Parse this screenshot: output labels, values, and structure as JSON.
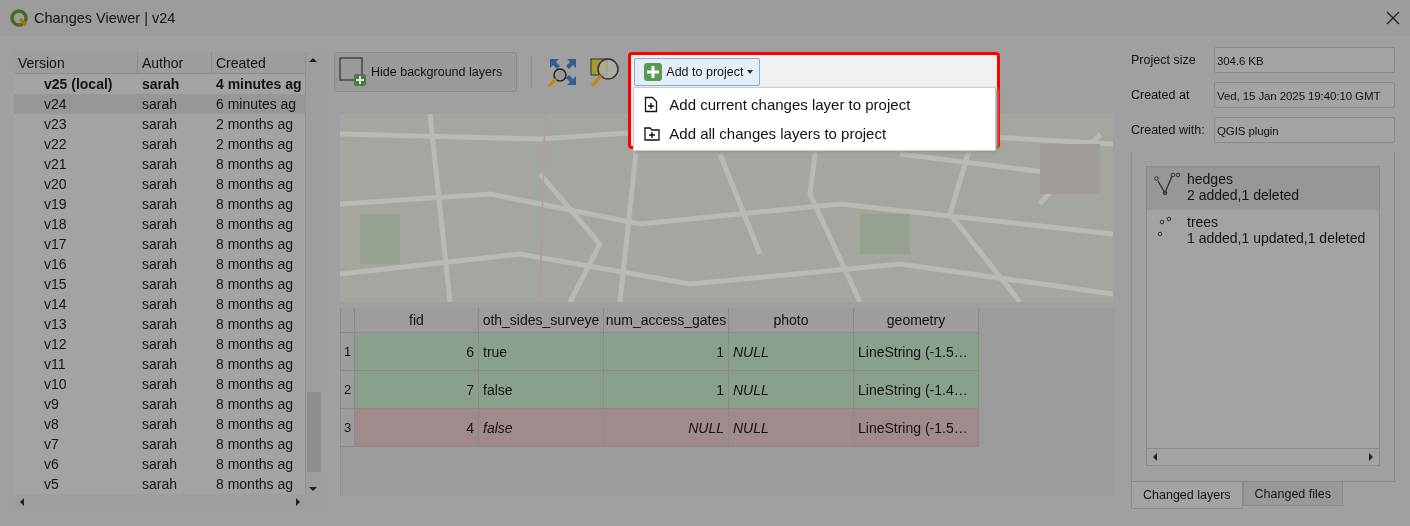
{
  "window": {
    "title": "Changes Viewer | v24"
  },
  "versions": {
    "columns": [
      "Version",
      "Author",
      "Created"
    ],
    "rows": [
      {
        "version": "v25 (local)",
        "author": "sarah",
        "created": "4 minutes ag",
        "local": true,
        "selected": false
      },
      {
        "version": "v24",
        "author": "sarah",
        "created": "6 minutes ag",
        "local": false,
        "selected": true
      },
      {
        "version": "v23",
        "author": "sarah",
        "created": "2 months ag",
        "local": false,
        "selected": false
      },
      {
        "version": "v22",
        "author": "sarah",
        "created": "2 months ag",
        "local": false,
        "selected": false
      },
      {
        "version": "v21",
        "author": "sarah",
        "created": "8 months ag",
        "local": false,
        "selected": false
      },
      {
        "version": "v20",
        "author": "sarah",
        "created": "8 months ag",
        "local": false,
        "selected": false
      },
      {
        "version": "v19",
        "author": "sarah",
        "created": "8 months ag",
        "local": false,
        "selected": false
      },
      {
        "version": "v18",
        "author": "sarah",
        "created": "8 months ag",
        "local": false,
        "selected": false
      },
      {
        "version": "v17",
        "author": "sarah",
        "created": "8 months ag",
        "local": false,
        "selected": false
      },
      {
        "version": "v16",
        "author": "sarah",
        "created": "8 months ag",
        "local": false,
        "selected": false
      },
      {
        "version": "v15",
        "author": "sarah",
        "created": "8 months ag",
        "local": false,
        "selected": false
      },
      {
        "version": "v14",
        "author": "sarah",
        "created": "8 months ag",
        "local": false,
        "selected": false
      },
      {
        "version": "v13",
        "author": "sarah",
        "created": "8 months ag",
        "local": false,
        "selected": false
      },
      {
        "version": "v12",
        "author": "sarah",
        "created": "8 months ag",
        "local": false,
        "selected": false
      },
      {
        "version": "v11",
        "author": "sarah",
        "created": "8 months ag",
        "local": false,
        "selected": false
      },
      {
        "version": "v10",
        "author": "sarah",
        "created": "8 months ag",
        "local": false,
        "selected": false
      },
      {
        "version": "v9",
        "author": "sarah",
        "created": "8 months ag",
        "local": false,
        "selected": false
      },
      {
        "version": "v8",
        "author": "sarah",
        "created": "8 months ag",
        "local": false,
        "selected": false
      },
      {
        "version": "v7",
        "author": "sarah",
        "created": "8 months ag",
        "local": false,
        "selected": false
      },
      {
        "version": "v6",
        "author": "sarah",
        "created": "8 months ag",
        "local": false,
        "selected": false
      },
      {
        "version": "v5",
        "author": "sarah",
        "created": "8 months ag",
        "local": false,
        "selected": false
      }
    ]
  },
  "toolbar": {
    "hide_background_button": "Hide background layers",
    "add_to_project_button": "Add to project",
    "menu_items": [
      {
        "label": "Add current changes layer to project",
        "kind": "file"
      },
      {
        "label": "Add all changes layers to project",
        "kind": "folder"
      }
    ]
  },
  "attribute_table": {
    "columns": [
      {
        "label": "fid",
        "kind": "number"
      },
      {
        "label": "oth_sides_surveye",
        "kind": "text"
      },
      {
        "label": "num_access_gates",
        "kind": "number"
      },
      {
        "label": "photo",
        "kind": "text"
      },
      {
        "label": "geometry",
        "kind": "text"
      }
    ],
    "rows": [
      {
        "header": "1",
        "kind": "added",
        "cells": [
          {
            "text": "6",
            "italic": false
          },
          {
            "text": "true",
            "italic": false
          },
          {
            "text": "1",
            "italic": false
          },
          {
            "text": "NULL",
            "italic": true
          },
          {
            "text": "LineString (-1.5…",
            "italic": false
          }
        ]
      },
      {
        "header": "2",
        "kind": "added",
        "cells": [
          {
            "text": "7",
            "italic": false
          },
          {
            "text": "false",
            "italic": false
          },
          {
            "text": "1",
            "italic": false
          },
          {
            "text": "NULL",
            "italic": true
          },
          {
            "text": "LineString (-1.4…",
            "italic": false
          }
        ]
      },
      {
        "header": "3",
        "kind": "deleted",
        "cells": [
          {
            "text": "4",
            "italic": false
          },
          {
            "text": "false",
            "italic": true
          },
          {
            "text": "NULL",
            "italic": true
          },
          {
            "text": "NULL",
            "italic": true
          },
          {
            "text": "LineString (-1.5…",
            "italic": false
          }
        ]
      }
    ]
  },
  "info": {
    "fields": [
      {
        "label": "Project size",
        "value": "304.6 KB"
      },
      {
        "label": "Created at",
        "value": "Ved, 15 Jan 2025 19:40:10 GMT"
      },
      {
        "label": "Created with:",
        "value": "QGIS plugin"
      }
    ],
    "layers": [
      {
        "name": "hedges",
        "summary": "2 added,1 deleted",
        "kind": "line",
        "selected": true
      },
      {
        "name": "trees",
        "summary": "1 added,1 updated,1 deleted",
        "kind": "point",
        "selected": false
      }
    ],
    "tabs": [
      {
        "label": "Changed layers",
        "selected": true
      },
      {
        "label": "Changed files",
        "selected": false
      }
    ]
  }
}
